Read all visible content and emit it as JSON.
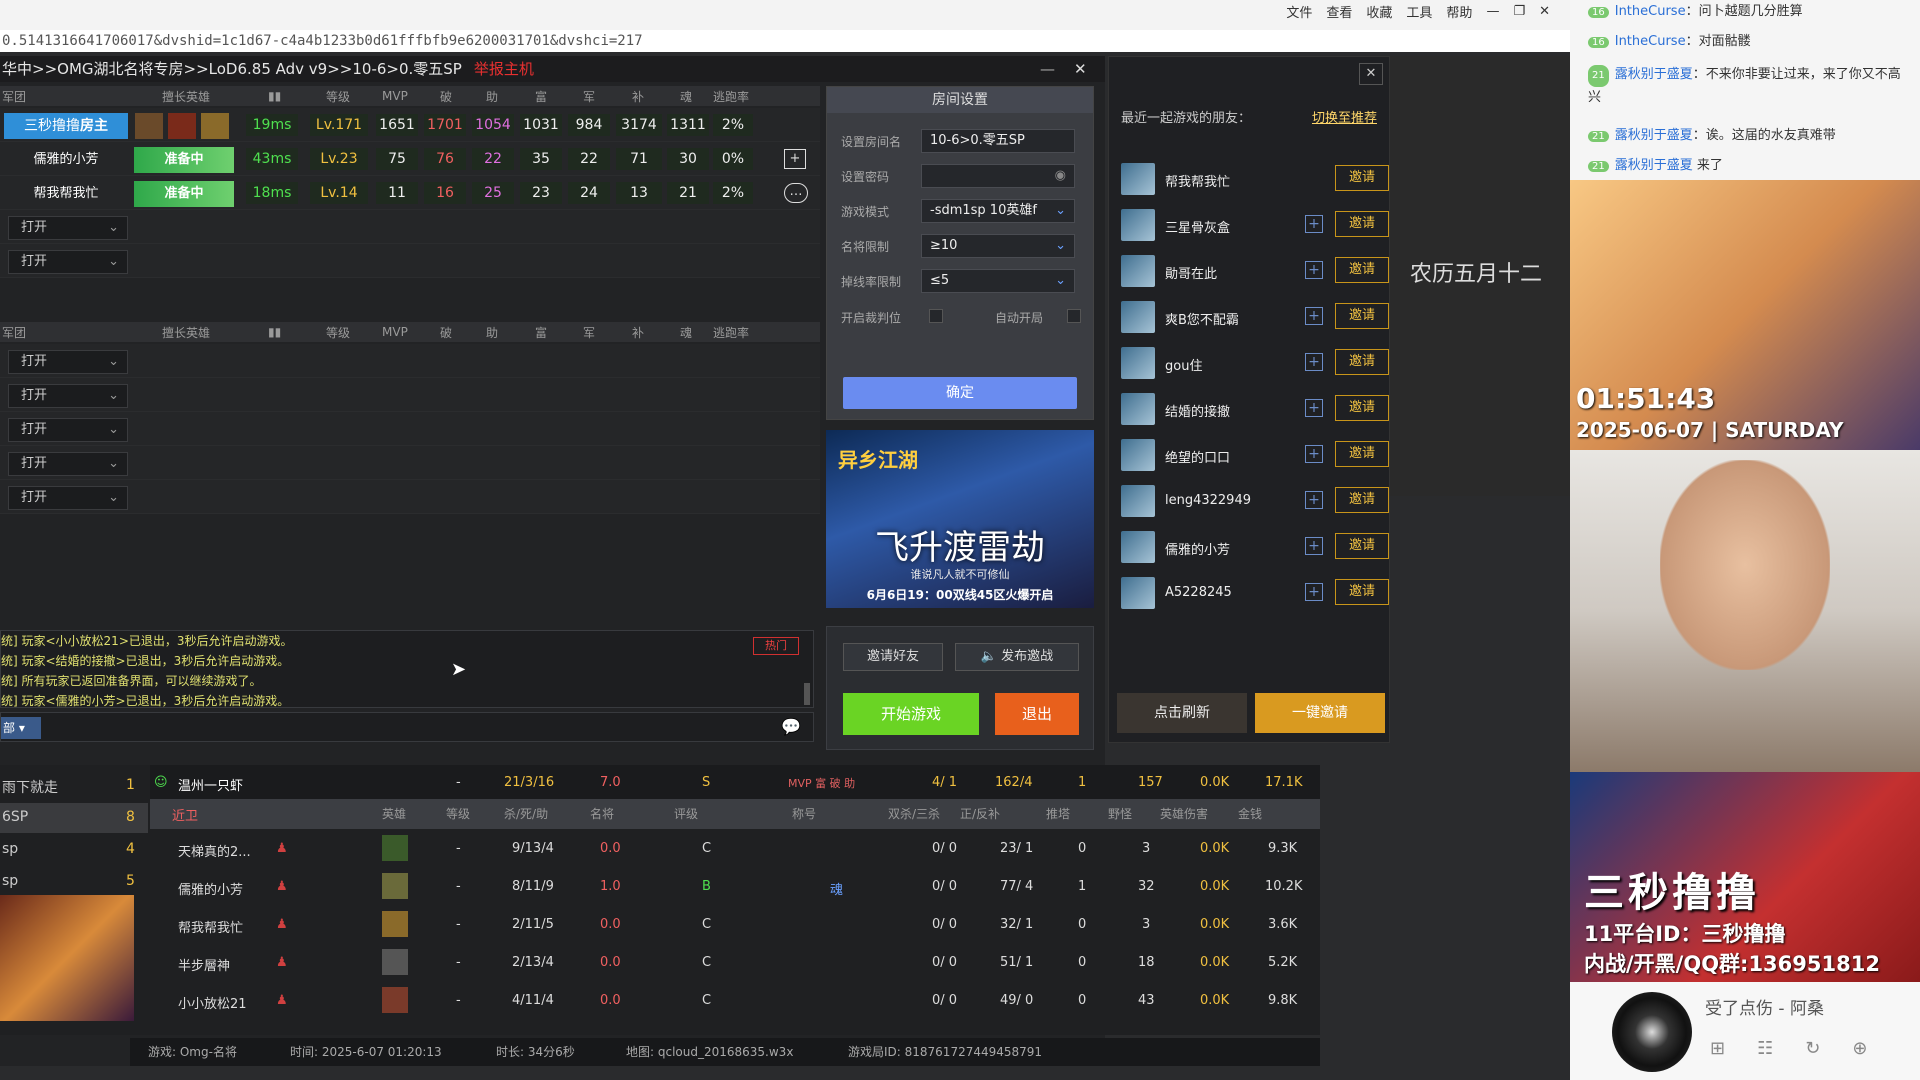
{
  "browser": {
    "menu": [
      "文件",
      "查看",
      "收藏",
      "工具",
      "帮助"
    ],
    "url": "0.5141316641706017&dvshid=1c1d67-c4a4b1233b0d61fffbfb9e6200031701&dvshci=217"
  },
  "lobby": {
    "title": "华中>>OMG湖北名将专房>>LoD6.85 Adv v9>>10-6>0.零五SP",
    "host_tag": "举报主机",
    "team1_label": "军团",
    "team2_label": "军团",
    "headers": [
      "擅长英雄",
      "等级",
      "MVP",
      "破",
      "助",
      "富",
      "军",
      "补",
      "魂",
      "逃跑率"
    ],
    "players": [
      {
        "name": "三秒撸撸",
        "role": "房主",
        "status": "",
        "ping": "19ms",
        "level": "Lv.171",
        "mvp": "1651",
        "po": "1701",
        "zhu": "1054",
        "fu": "1031",
        "jun": "984",
        "bu": "3174",
        "hun": "1311",
        "escape": "2%"
      },
      {
        "name": "儒雅的小芳",
        "role": "",
        "status": "准备中",
        "ping": "43ms",
        "level": "Lv.23",
        "mvp": "75",
        "po": "76",
        "zhu": "22",
        "fu": "35",
        "jun": "22",
        "bu": "71",
        "hun": "30",
        "escape": "0%"
      },
      {
        "name": "帮我帮我忙",
        "role": "",
        "status": "准备中",
        "ping": "18ms",
        "level": "Lv.14",
        "mvp": "11",
        "po": "16",
        "zhu": "25",
        "fu": "23",
        "jun": "24",
        "bu": "13",
        "hun": "21",
        "escape": "2%"
      }
    ],
    "open_label": "打开"
  },
  "room": {
    "title": "房间设置",
    "fields": [
      {
        "label": "设置房间名",
        "value": "10-6>0.零五SP"
      },
      {
        "label": "设置密码",
        "value": ""
      },
      {
        "label": "游戏模式",
        "value": "-sdm1sp 10英雄f"
      },
      {
        "label": "名将限制",
        "value": "≥10"
      },
      {
        "label": "掉线率限制",
        "value": "≤5"
      }
    ],
    "judge_label": "开启裁判位",
    "autostart_label": "自动开局",
    "confirm": "确定"
  },
  "banner": {
    "logo": "异乡江湖",
    "title": "飞升渡雷劫",
    "sub": "谁说凡人就不可修仙",
    "date": "6月6日19：00双线45区火爆开启"
  },
  "chat": {
    "hot": "热门",
    "lines": [
      "统] 玩家<小小放松21>已退出，3秒后允许启动游戏。",
      "统] 玩家<结婚的接撤>已退出，3秒后允许启动游戏。",
      "统] 所有玩家已返回准备界面，可以继续游戏了。",
      "统] 玩家<儒雅的小芳>已退出，3秒后允许启动游戏。"
    ],
    "channel": "部"
  },
  "actions": {
    "invite_friend": "邀请好友",
    "publish": "发布邀战",
    "start": "开始游戏",
    "quit": "退出"
  },
  "friends": {
    "header": "最近一起游戏的朋友：",
    "switch": "切换至推荐",
    "invite": "邀请",
    "list": [
      "帮我帮我忙",
      "三星骨灰盒",
      "勛哥在此",
      "爽B您不配霸",
      "gou住",
      "结婚的接撤",
      "绝望的口口",
      "leng4322949",
      "儒雅的小芳",
      "A5228245"
    ],
    "refresh": "点击刷新",
    "invite_all": "一键邀请"
  },
  "stats": {
    "left": [
      {
        "name": "雨下就走",
        "num": "1"
      },
      {
        "name": "6SP",
        "num": "8"
      },
      {
        "name": "sp",
        "num": "4"
      },
      {
        "name": "sp",
        "num": "5"
      }
    ],
    "summary": {
      "name": "温州一只虾",
      "dash": "-",
      "kda": "21/3/16",
      "score": "7.0",
      "grade": "S",
      "tags": "MVP 富 破 助",
      "double": "4/ 1",
      "cs": "162/4",
      "tower": "1",
      "wild": "157",
      "dmg": "0.0K",
      "gold": "17.1K"
    },
    "header": {
      "team": "近卫",
      "hero": "英雄",
      "level": "等级",
      "kda": "杀/死/助",
      "mingjiang": "名将",
      "grade": "评级",
      "title": "称号",
      "double": "双杀/三杀",
      "cs": "正/反补",
      "tower": "推塔",
      "wild": "野怪",
      "dmg": "英雄伤害",
      "gold": "金钱"
    },
    "rows": [
      {
        "name": "天梯真的2...",
        "dash": "-",
        "kda": "9/13/4",
        "score": "0.0",
        "grade": "C",
        "title": "",
        "double": "0/ 0",
        "cs": "23/ 1",
        "tower": "0",
        "wild": "3",
        "dmg": "0.0K",
        "gold": "9.3K"
      },
      {
        "name": "儒雅的小芳",
        "dash": "-",
        "kda": "8/11/9",
        "score": "1.0",
        "grade": "B",
        "title": "魂",
        "double": "0/ 0",
        "cs": "77/ 4",
        "tower": "1",
        "wild": "32",
        "dmg": "0.0K",
        "gold": "10.2K"
      },
      {
        "name": "帮我帮我忙",
        "dash": "-",
        "kda": "2/11/5",
        "score": "0.0",
        "grade": "C",
        "title": "",
        "double": "0/ 0",
        "cs": "32/ 1",
        "tower": "0",
        "wild": "3",
        "dmg": "0.0K",
        "gold": "3.6K"
      },
      {
        "name": "半步層神",
        "dash": "-",
        "kda": "2/13/4",
        "score": "0.0",
        "grade": "C",
        "title": "",
        "double": "0/ 0",
        "cs": "51/ 1",
        "tower": "0",
        "wild": "18",
        "dmg": "0.0K",
        "gold": "5.2K"
      },
      {
        "name": "小小放松21",
        "dash": "-",
        "kda": "4/11/4",
        "score": "0.0",
        "grade": "C",
        "title": "",
        "double": "0/ 0",
        "cs": "49/ 0",
        "tower": "0",
        "wild": "43",
        "dmg": "0.0K",
        "gold": "9.8K"
      }
    ],
    "status": {
      "game": "游戏: Omg-名将",
      "time": "时间: 2025-6-07 01:20:13",
      "duration": "时长: 34分6秒",
      "map": "地图: qcloud_20168635.w3x",
      "gid": "游戏局ID: 818761727449458791"
    }
  },
  "stream": {
    "comments": [
      {
        "lv": "16",
        "user": "IntheCurse",
        "text": "：问卜越题几分胜算"
      },
      {
        "lv": "16",
        "user": "IntheCurse",
        "text": "：对面骷髅"
      },
      {
        "lv": "21",
        "user": "露秋别于盛夏",
        "text": "：不来你非要让过来，来了你又不高兴"
      },
      {
        "lv": "21",
        "user": "露秋别于盛夏",
        "text": "：诶。这届的水友真难带"
      },
      {
        "lv": "21",
        "user": "露秋别于盛夏",
        "text": "来了"
      }
    ],
    "clock": "01:51:43",
    "date": "2025-06-07 | SATURDAY",
    "promo_big": "三秒撸撸",
    "promo_l1": "11平台ID：三秒撸撸",
    "promo_l2": "内战/开黑/QQ群:136951812",
    "song": "受了点伤 - 阿桑",
    "calendar": "农历五月十二"
  }
}
